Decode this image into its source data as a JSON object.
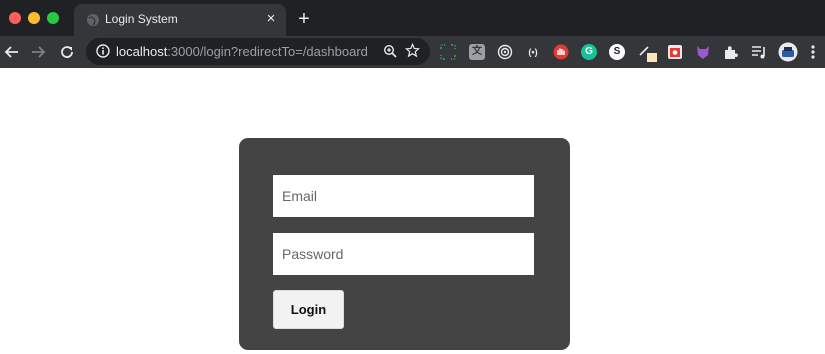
{
  "browser": {
    "tab": {
      "title": "Login System",
      "close_glyph": "×"
    },
    "new_tab_glyph": "+",
    "address": {
      "host": "localhost",
      "path": ":3000/login?redirectTo=/dashboard"
    },
    "extensions": [
      "bracket-extension-icon",
      "translate-extension-icon",
      "target-extension-icon",
      "broadcast-extension-icon",
      "hand-extension-icon",
      "grammarly-extension-icon",
      "s-extension-icon",
      "pen-extension-icon",
      "screenshot-extension-icon",
      "fox-extension-icon",
      "puzzle-icon",
      "playlist-icon",
      "profile-avatar"
    ]
  },
  "login_form": {
    "email_placeholder": "Email",
    "password_placeholder": "Password",
    "login_label": "Login"
  },
  "colors": {
    "tabbar_bg": "#202124",
    "toolbar_bg": "#35363a",
    "card_bg": "#444444",
    "page_bg": "#ffffff"
  }
}
